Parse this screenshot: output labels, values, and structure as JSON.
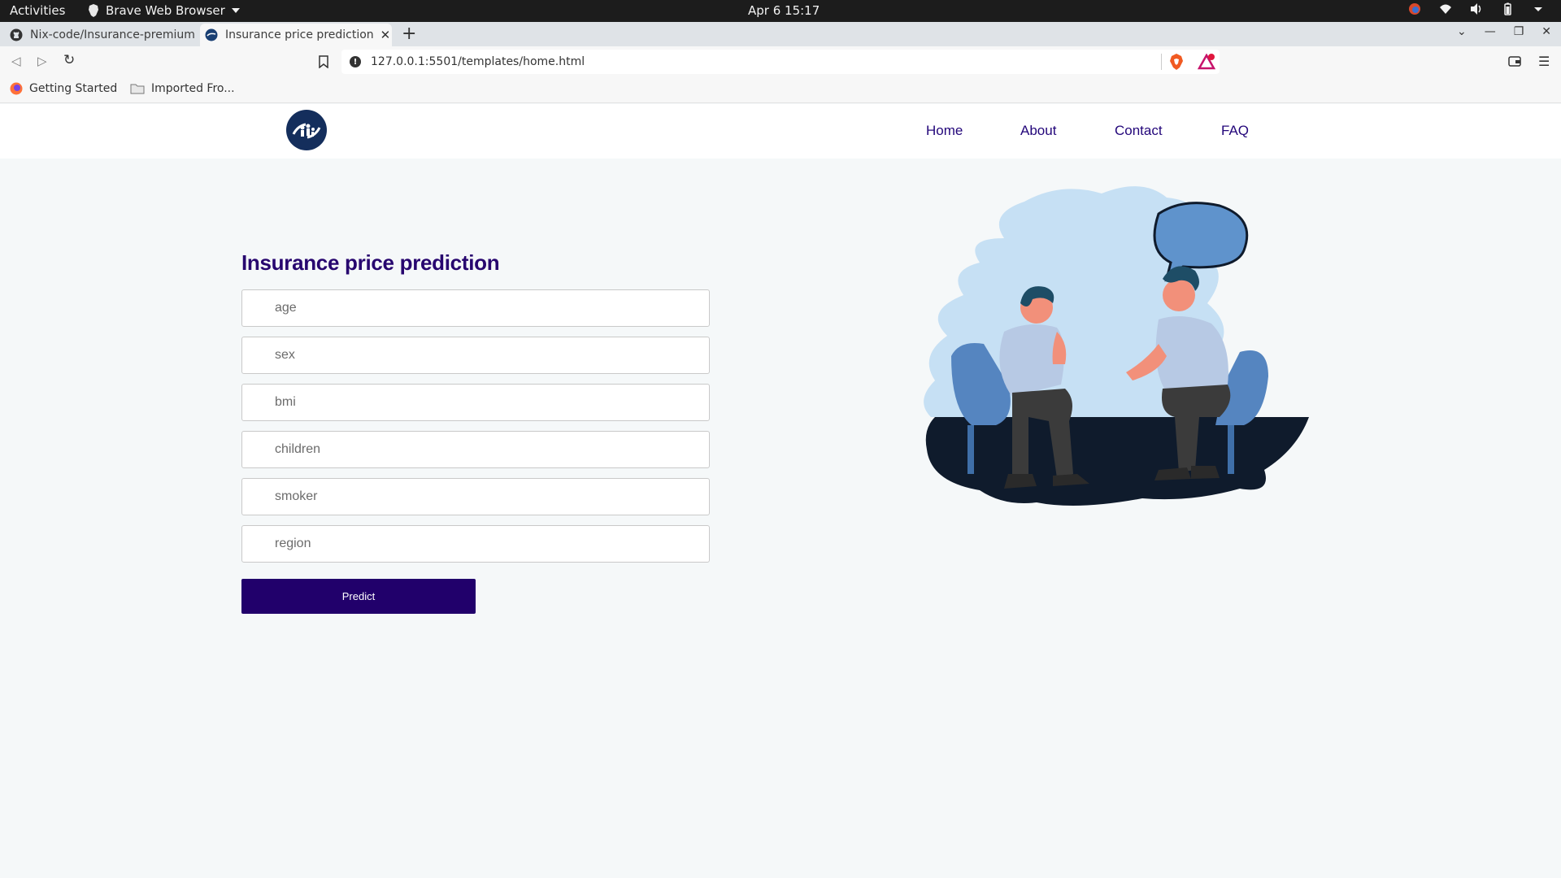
{
  "system_bar": {
    "activities": "Activities",
    "app_name": "Brave Web Browser",
    "clock": "Apr 6  15:17"
  },
  "tabs": [
    {
      "title": "Nix-code/Insurance-premium",
      "icon": "github-icon"
    },
    {
      "title": "Insurance price prediction",
      "icon": "globe-icon",
      "active": true
    }
  ],
  "address_bar": {
    "url": "127.0.0.1:5501/templates/home.html"
  },
  "bookmarks": [
    {
      "label": "Getting Started",
      "icon": "firefox-icon"
    },
    {
      "label": "Imported Fro...",
      "icon": "folder-icon"
    }
  ],
  "site": {
    "nav": [
      {
        "label": "Home"
      },
      {
        "label": "About"
      },
      {
        "label": "Contact"
      },
      {
        "label": "FAQ"
      }
    ],
    "form": {
      "title": "Insurance price prediction",
      "fields": [
        {
          "placeholder": "age"
        },
        {
          "placeholder": "sex"
        },
        {
          "placeholder": "bmi"
        },
        {
          "placeholder": "children"
        },
        {
          "placeholder": "smoker"
        },
        {
          "placeholder": "region"
        }
      ],
      "submit_label": "Predict"
    }
  },
  "colors": {
    "brand": "#21006b",
    "nav_text": "#23067a",
    "page_bg": "#f5f8f9"
  }
}
